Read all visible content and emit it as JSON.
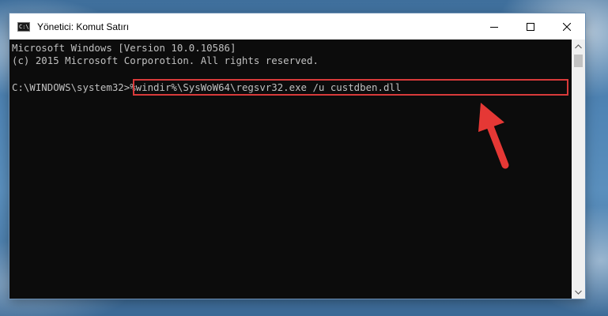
{
  "window": {
    "title": "Yönetici: Komut Satırı",
    "icon": "cmd-icon",
    "icon_glyph": "C:\\",
    "controls": {
      "minimize": "minimize-icon",
      "maximize": "maximize-icon",
      "close": "close-icon"
    }
  },
  "console": {
    "lines": [
      "Microsoft Windows [Version 10.0.10586]",
      "(c) 2015 Microsoft Corporotion. All rights reserved."
    ],
    "prompt": "C:\\WINDOWS\\system32>",
    "command": "%windir%\\SysWoW64\\regsvr32.exe /u custdben.dll",
    "text_color": "#c0c0c0",
    "background": "#0c0c0c"
  },
  "annotation": {
    "highlight_color": "#d83a3a",
    "arrow_color": "#e53935"
  }
}
